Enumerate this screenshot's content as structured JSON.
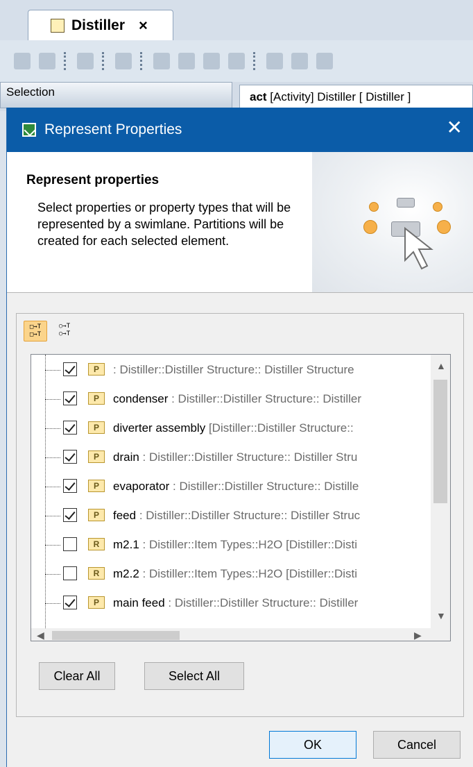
{
  "editor": {
    "tab_title": "Distiller",
    "tab_close": "×",
    "selection_label": "Selection",
    "diagram_tab_prefix": "act",
    "diagram_tab_rest": " [Activity] Distiller [ Distiller ]"
  },
  "dialog": {
    "title": "Represent Properties",
    "close_glyph": "✕",
    "heading": "Represent properties",
    "description": "Select properties or property types that will be represented by a swimlane. Partitions will be created for each selected element.",
    "mode_buttons": [
      {
        "glyph": "□→T\n□→T"
      },
      {
        "glyph": "○→T\n○→T"
      }
    ],
    "tree_rows": [
      {
        "checked": true,
        "tag": "P",
        "name": "",
        "type": " : Distiller::Distiller Structure:: Distiller Structure"
      },
      {
        "checked": true,
        "tag": "P",
        "name": "condenser",
        "type": " : Distiller::Distiller Structure:: Distiller"
      },
      {
        "checked": true,
        "tag": "P",
        "name": "diverter assembly",
        "type": " [Distiller::Distiller Structure:: "
      },
      {
        "checked": true,
        "tag": "P",
        "name": "drain",
        "type": " : Distiller::Distiller Structure:: Distiller Stru"
      },
      {
        "checked": true,
        "tag": "P",
        "name": "evaporator",
        "type": " : Distiller::Distiller Structure:: Distille"
      },
      {
        "checked": true,
        "tag": "P",
        "name": "feed",
        "type": " : Distiller::Distiller Structure:: Distiller Struc"
      },
      {
        "checked": false,
        "tag": "R",
        "name": "m2.1",
        "type": " : Distiller::Item Types::H2O [Distiller::Disti"
      },
      {
        "checked": false,
        "tag": "R",
        "name": "m2.2",
        "type": " : Distiller::Item Types::H2O [Distiller::Disti"
      },
      {
        "checked": true,
        "tag": "P",
        "name": "main feed",
        "type": " : Distiller::Distiller Structure:: Distiller"
      }
    ],
    "clear_all": "Clear All",
    "select_all": "Select All",
    "ok": "OK",
    "cancel": "Cancel"
  },
  "colors": {
    "titlebar": "#0b5ca8",
    "accent_orange": "#f6b04a"
  }
}
